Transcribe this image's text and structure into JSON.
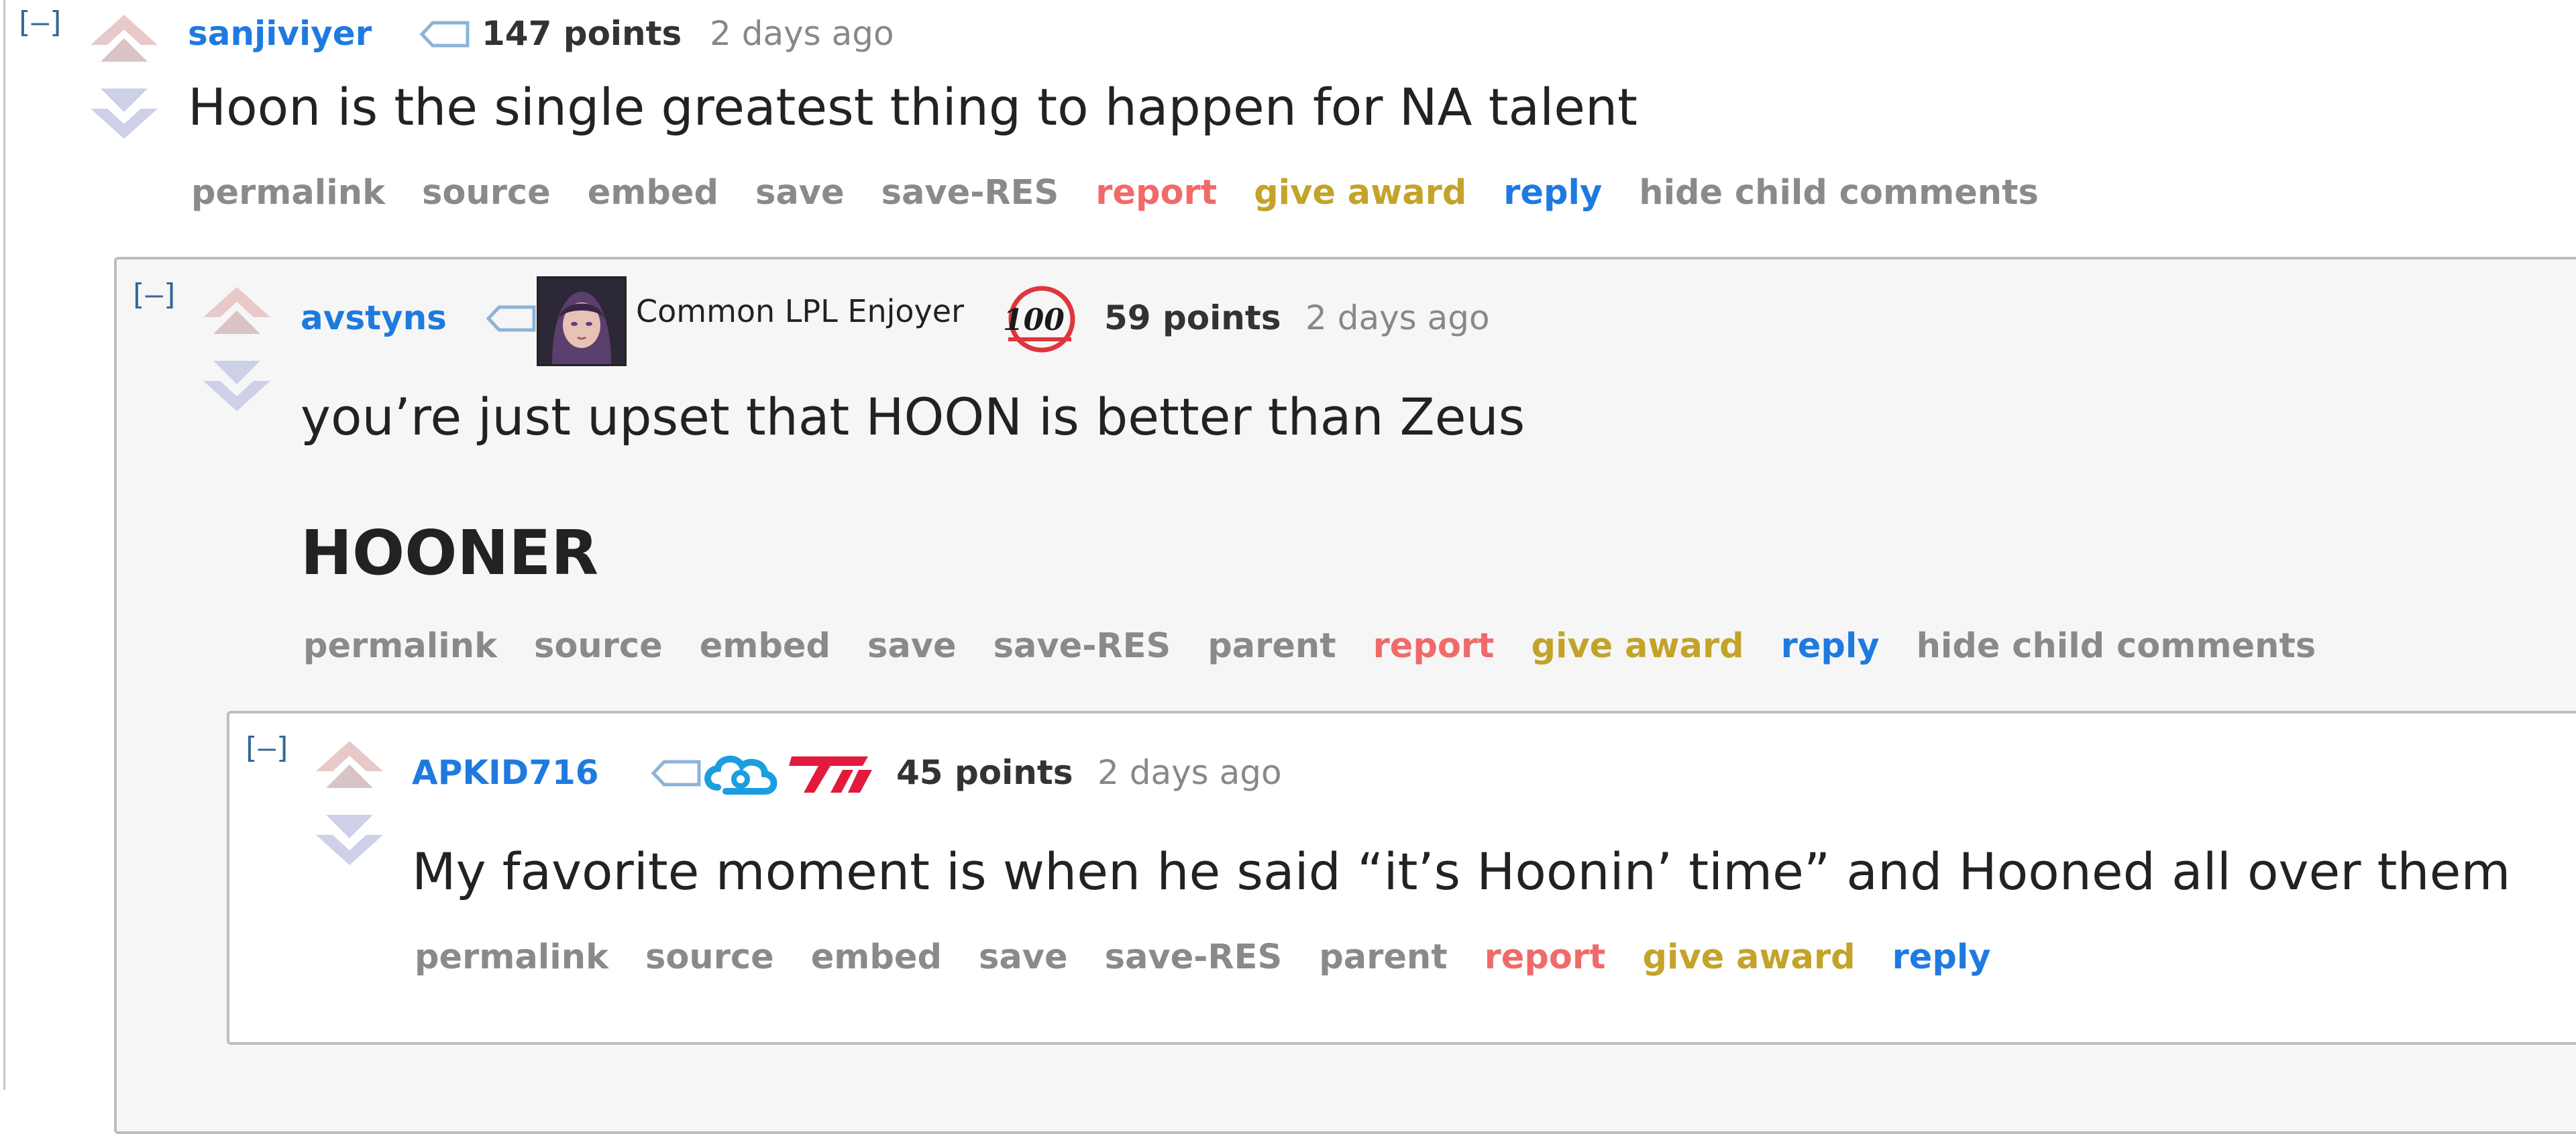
{
  "colors": {
    "author": "#1f7ae0",
    "report": "#f06a6a",
    "award": "#c3a32a",
    "reply": "#1f7ae0",
    "muted": "#8a8a8a",
    "nest_bg": "#f6f6f6"
  },
  "comments": [
    {
      "collapse_label": "[–]",
      "author": "sanjiviyer",
      "score": "147 points",
      "time": "2 days ago",
      "body": "Hoon is the single greatest thing to happen for NA talent",
      "actions": [
        "permalink",
        "source",
        "embed",
        "save",
        "save-RES",
        "report",
        "give award",
        "reply",
        "hide child comments"
      ]
    },
    {
      "collapse_label": "[–]",
      "author": "avstyns",
      "flair_text": "Common LPL Enjoyer",
      "flair_icons": [
        "avatar-portrait-icon",
        "100-thieves-logo-icon"
      ],
      "score": "59 points",
      "time": "2 days ago",
      "body": "you’re just upset that HOON is better than Zeus",
      "heading": "HOONER",
      "actions": [
        "permalink",
        "source",
        "embed",
        "save",
        "save-RES",
        "parent",
        "report",
        "give award",
        "reply",
        "hide child comments"
      ]
    },
    {
      "collapse_label": "[–]",
      "author": "APKID716",
      "flair_icons": [
        "cloud9-logo-icon",
        "t1-logo-icon"
      ],
      "score": "45 points",
      "time": "2 days ago",
      "body": "My favorite moment is when he said “it’s Hoonin’ time” and Hooned all over them",
      "actions": [
        "permalink",
        "source",
        "embed",
        "save",
        "save-RES",
        "parent",
        "report",
        "give award",
        "reply"
      ]
    }
  ]
}
